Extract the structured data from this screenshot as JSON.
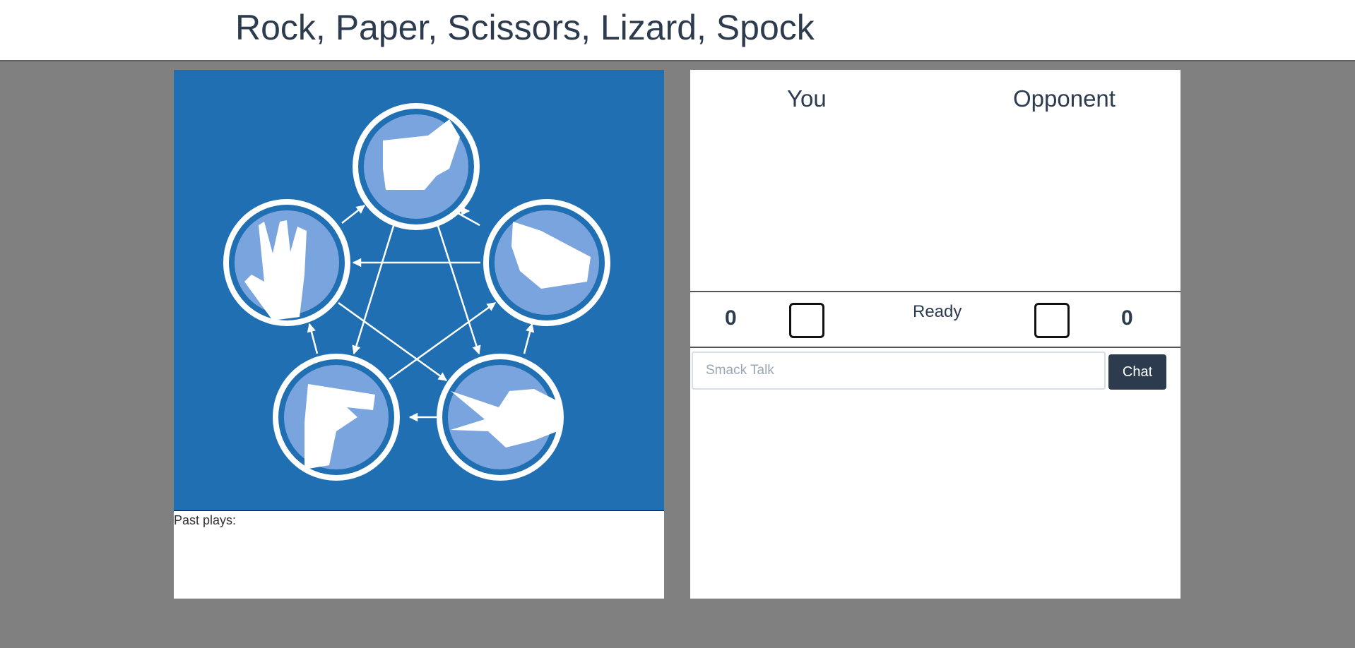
{
  "header": {
    "title": "Rock, Paper, Scissors, Lizard, Spock"
  },
  "game_image": {
    "icons": [
      "rock-icon",
      "paper-icon",
      "scissors-icon",
      "lizard-icon",
      "spock-icon"
    ],
    "background_color": "#1f6fb2",
    "circle_color": "#7aa4de"
  },
  "past_plays": {
    "label": "Past plays:"
  },
  "players": {
    "you_label": "You",
    "opponent_label": "Opponent",
    "you_score": "0",
    "opponent_score": "0",
    "ready_label": "Ready"
  },
  "chat": {
    "placeholder": "Smack Talk",
    "value": "",
    "button_label": "Chat"
  },
  "colors": {
    "accent": "#2d3b4e",
    "page_background": "#808080"
  }
}
